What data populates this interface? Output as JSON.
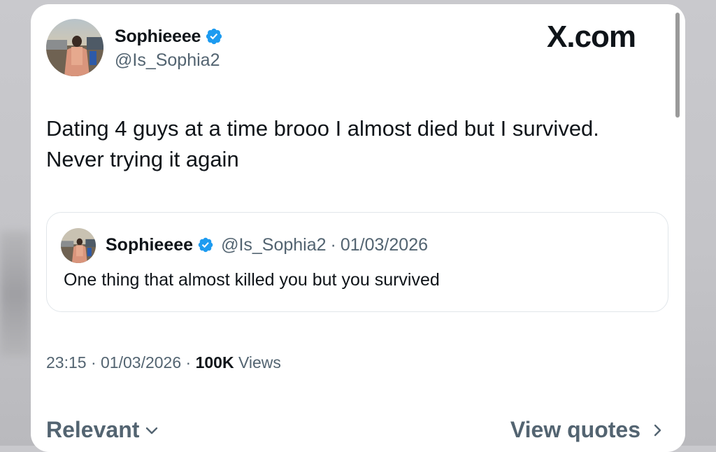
{
  "tweet": {
    "display_name": "Sophieeee",
    "handle": "@Is_Sophia2",
    "verified": true,
    "text_line1": "Dating 4 guys at a time brooo I almost died but I survived.",
    "text_line2": "Never trying it again",
    "time": "23:15",
    "date": "01/03/2026",
    "views_count": "100K",
    "views_label": "Views",
    "separator": "·"
  },
  "brand": {
    "logo_text": "X.com"
  },
  "quote": {
    "display_name": "Sophieeee",
    "handle": "@Is_Sophia2",
    "separator": "·",
    "date": "01/03/2026",
    "text": "One thing that almost killed you but you survived"
  },
  "footer": {
    "sort_label": "Relevant",
    "view_quotes_label": "View quotes"
  },
  "colors": {
    "verified_blue": "#1d9bf0",
    "text_primary": "#0f1419",
    "text_secondary": "#536471"
  },
  "icons": {
    "verified": "verified-badge-icon",
    "sort_chevron": "chevron-down-icon",
    "view_quotes_chevron": "chevron-right-icon"
  }
}
